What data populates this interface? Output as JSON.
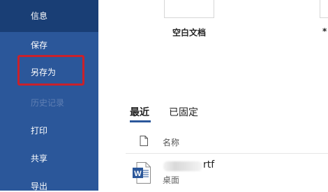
{
  "sidebar": {
    "items": [
      {
        "label": "信息"
      },
      {
        "label": "保存"
      },
      {
        "label": "另存为"
      },
      {
        "label": "历史记录"
      },
      {
        "label": "打印"
      },
      {
        "label": "共享"
      },
      {
        "label": "导出"
      }
    ],
    "selected_index": 0,
    "highlighted_index": 2,
    "background_color": "#2b579a",
    "highlight_color": "#c9212b"
  },
  "templates": {
    "blank_label": "空白文档",
    "partial_label": "*"
  },
  "tabs": [
    {
      "label": "最近",
      "active": true
    },
    {
      "label": "已固定",
      "active": false
    }
  ],
  "file_list": {
    "header": "名称",
    "files": [
      {
        "name": "rtf",
        "location": "桌面",
        "icon": "word-doc-icon"
      }
    ]
  }
}
